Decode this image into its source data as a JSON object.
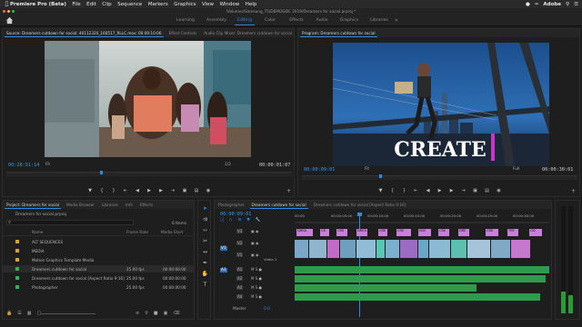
{
  "menubar": {
    "app": "Premiere Pro (Beta)",
    "items": [
      "File",
      "Edit",
      "Clip",
      "Sequence",
      "Markers",
      "Graphics",
      "View",
      "Window",
      "Help"
    ],
    "right": "Adobe"
  },
  "window_title": "/Volumes/Samsung_T5/DEMOS/BC 2019/Dreamers for social.prproj *",
  "workspaces": [
    "Learning",
    "Assembly",
    "Editing",
    "Color",
    "Effects",
    "Audio",
    "Graphics",
    "Libraries"
  ],
  "active_workspace": "Editing",
  "source": {
    "tabs": [
      "Source: Dreamers cutdown for social: 40112320_160517_RLLC.mov: 00:00:10:06",
      "Effect Controls",
      "Audio Clip Mixer: Dreamers cutdown for social"
    ],
    "timecode": "00:28:51:14",
    "fit": "Fit",
    "ratio": "1/2",
    "duration": "00:00:01:07"
  },
  "program": {
    "tabs": [
      "Program: Dreamers cutdown for social"
    ],
    "timecode": "00:00:09:01",
    "fit": "Fit",
    "quality": "Full",
    "duration": "00:00:30:01",
    "overlay_text": "CREATE"
  },
  "project": {
    "tabs": [
      "Project: Dreamers for social",
      "Media Browser",
      "Libraries",
      "Info",
      "Effects"
    ],
    "name": "Dreamers for social.prproj",
    "count": "6 Items",
    "columns": [
      "Name",
      "Frame Rate",
      "Media Start"
    ],
    "rows": [
      {
        "name": "ALT SEQUENCES",
        "fps": "",
        "start": "",
        "color": "#e0a12c"
      },
      {
        "name": "MEDIA",
        "fps": "",
        "start": "",
        "color": "#e0a12c"
      },
      {
        "name": "Motion Graphics Template Media",
        "fps": "",
        "start": "",
        "color": "#e0a12c"
      },
      {
        "name": "Dreamers cutdown for social",
        "fps": "25.00 fps",
        "start": "00:00:00:00",
        "color": "#34b34a"
      },
      {
        "name": "Dreamers cutdown for social [Aspect Ratio 9:16]",
        "fps": "25.00 fps",
        "start": "00:00:00:00",
        "color": "#34b34a"
      },
      {
        "name": "Photographer",
        "fps": "25.00 fps",
        "start": "00:00:00:00",
        "color": "#34b34a"
      }
    ]
  },
  "timeline": {
    "tabs": [
      "Photographer",
      "Dreamers cutdown for social",
      "Dreamers cutdown for social [Aspect Ratio 9:16]"
    ],
    "timecode": "00:00:09:01",
    "ruler": [
      "00:00",
      "00:00:05:00",
      "00:00:10:00",
      "00:00:15:00",
      "00:00:20:00",
      "00:00:25:00",
      "00:00:30:00"
    ],
    "video_tracks": [
      "V3",
      "V2",
      "V1"
    ],
    "v1_name": "Video 1",
    "audio_tracks": [
      "A1",
      "A2",
      "A3",
      "A4"
    ],
    "master": "Master",
    "master_val": "0.0",
    "src_labels": [
      "V1",
      "A1"
    ],
    "clip_labels": [
      "DRRA",
      "CR",
      "CRE",
      "DREA",
      "CRE",
      "CRE",
      "ENS",
      "CRE",
      "DRE",
      "CRE",
      "TRY",
      "OD"
    ]
  }
}
